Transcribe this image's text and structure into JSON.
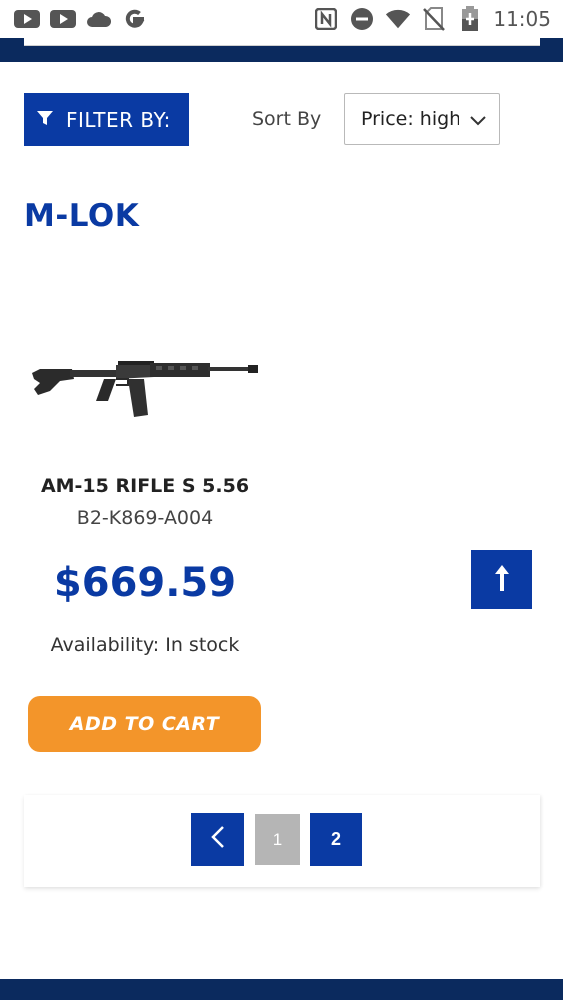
{
  "status_bar": {
    "time": "11:05",
    "left_icons": [
      "youtube-icon",
      "youtube-icon",
      "cloud-icon",
      "google-icon"
    ],
    "right_icons": [
      "nfc-icon",
      "do-not-disturb-icon",
      "wifi-icon",
      "no-sim-icon",
      "battery-charging-icon"
    ]
  },
  "toolbar": {
    "filter_label": "FILTER BY:",
    "sort_label": "Sort By",
    "sort_value": "Price: high to low"
  },
  "category": {
    "title": "M-LOK"
  },
  "product": {
    "name": "AM-15 RIFLE S 5.56",
    "sku": "B2-K869-A004",
    "price": "$669.59",
    "availability": "Availability: In stock",
    "add_to_cart_label": "ADD TO CART"
  },
  "pagination": {
    "pages": [
      "1",
      "2"
    ],
    "current": "2"
  },
  "colors": {
    "brand_blue": "#0a3aa3",
    "navy": "#0b2a5e",
    "cart_orange": "#f3952a"
  }
}
